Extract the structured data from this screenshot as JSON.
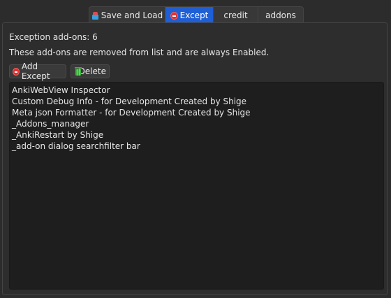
{
  "tabs": [
    {
      "label": "Save and Load",
      "icon": "save-load-icon",
      "active": false
    },
    {
      "label": "Except",
      "icon": "stop-icon",
      "active": true
    },
    {
      "label": "credit",
      "icon": "",
      "active": false
    },
    {
      "label": "addons",
      "icon": "",
      "active": false
    }
  ],
  "info": {
    "count_text": "Exception add-ons: 6",
    "description": "These add-ons are removed from list and are always Enabled."
  },
  "buttons": {
    "add_except": "Add Except",
    "delete": "Delete"
  },
  "list_items": [
    "AnkiWebView Inspector",
    "Custom Debug Info - for Development Created by Shige",
    "Meta json Formatter - for Development Created by Shige",
    "_Addons_manager",
    "_AnkiRestart by Shige",
    "_add-on dialog searchfilter bar"
  ],
  "colors": {
    "active_tab": "#1f5fd6",
    "background": "#2c2c2c",
    "list_background": "#1e1e1e"
  }
}
